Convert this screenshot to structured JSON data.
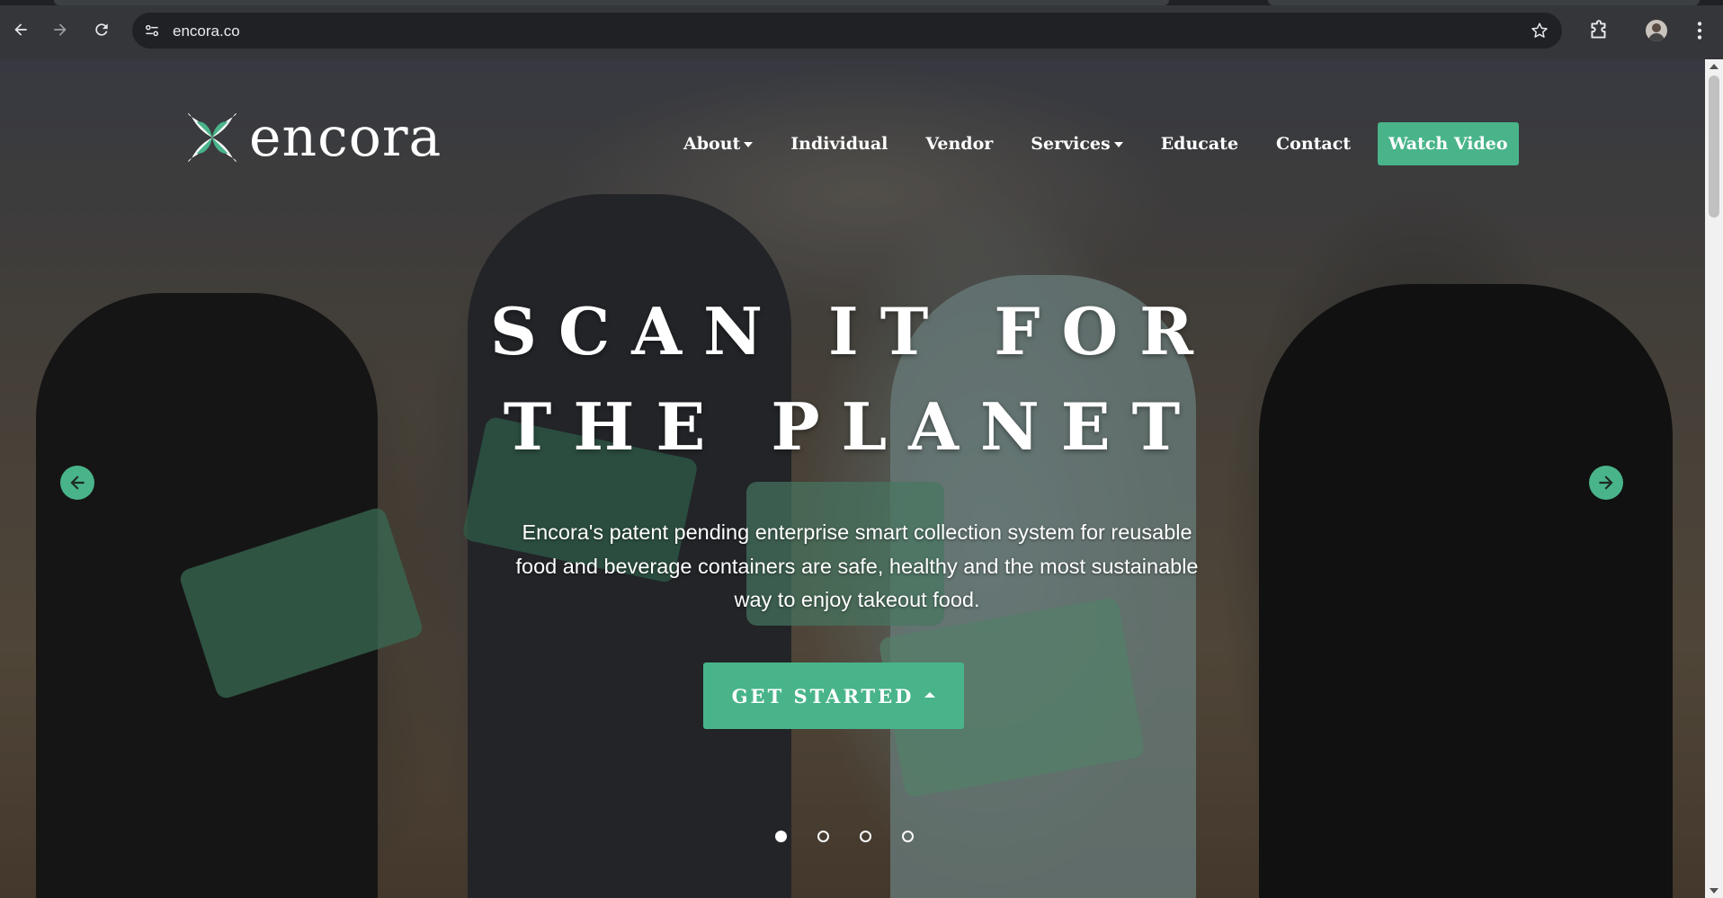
{
  "browser": {
    "url": "encora.co"
  },
  "site": {
    "brand_name": "encora",
    "nav": [
      {
        "label": "About",
        "dropdown": true
      },
      {
        "label": "Individual",
        "dropdown": false
      },
      {
        "label": "Vendor",
        "dropdown": false
      },
      {
        "label": "Services",
        "dropdown": true
      },
      {
        "label": "Educate",
        "dropdown": false
      },
      {
        "label": "Contact",
        "dropdown": false
      }
    ],
    "watch_video_label": "Watch Video"
  },
  "hero": {
    "headline_line1": "SCAN IT FOR",
    "headline_line2": "THE PLANET",
    "subtext": "Encora's patent pending enterprise smart collection system for reusable food and beverage containers are safe, healthy and the most sustainable way to enjoy takeout food.",
    "cta_label": "GET STARTED",
    "slide_count": 4,
    "active_slide": 1
  },
  "colors": {
    "accent": "#49b48a",
    "chrome_bg": "#35363a",
    "omnibox_bg": "#202124"
  }
}
